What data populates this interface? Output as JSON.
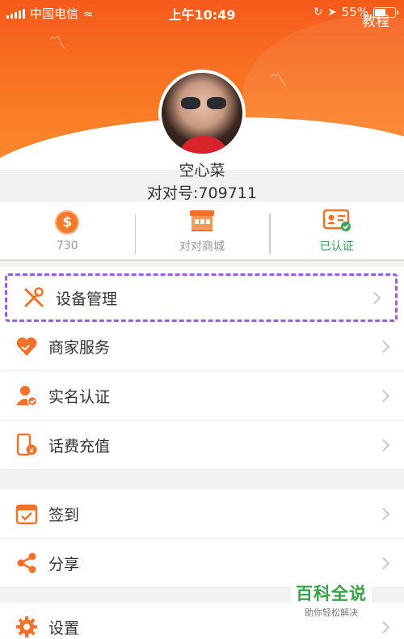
{
  "status_bar": {
    "carrier": "中国电信",
    "time": "上午10:49",
    "battery": "55%",
    "battery_level": 0.55
  },
  "header": {
    "tutorial_label": "教程"
  },
  "profile": {
    "name": "空心菜",
    "account_id": "对对号:709711"
  },
  "stats": [
    {
      "icon": "coin-icon",
      "label": "730"
    },
    {
      "icon": "store-icon",
      "label": "对对商城"
    },
    {
      "icon": "id-card-icon",
      "label": "已认证"
    }
  ],
  "menu_group1": [
    {
      "icon": "tools-icon",
      "label": "设备管理"
    },
    {
      "icon": "heart-icon",
      "label": "商家服务"
    },
    {
      "icon": "user-verify-icon",
      "label": "实名认证"
    },
    {
      "icon": "phone-recharge-icon",
      "label": "话费充值"
    }
  ],
  "menu_group2": [
    {
      "icon": "calendar-check-icon",
      "label": "签到"
    },
    {
      "icon": "share-icon",
      "label": "分享"
    }
  ],
  "menu_group3": [
    {
      "icon": "gear-icon",
      "label": "设置"
    }
  ],
  "watermark": {
    "title": "百科全说",
    "subtitle": "助你轻松解决"
  },
  "colors": {
    "accent": "#f4712a",
    "verified": "#3aa356",
    "highlight": "#9b5de5"
  }
}
